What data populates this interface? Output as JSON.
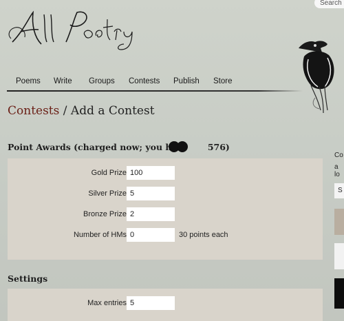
{
  "header": {
    "logo_text": "All Poetry",
    "search_label": "Search"
  },
  "nav": {
    "items": [
      {
        "label": "Poems"
      },
      {
        "label": "Write"
      },
      {
        "label": "Groups"
      },
      {
        "label": "Contests"
      },
      {
        "label": "Publish"
      },
      {
        "label": "Store"
      }
    ]
  },
  "breadcrumb": {
    "parent": "Contests",
    "separator": " / ",
    "current": "Add a Contest"
  },
  "point_awards": {
    "title_prefix": "Point Awards (charged now; you have",
    "title_suffix": "576)",
    "fields": [
      {
        "label": "Gold Prize",
        "value": "100",
        "suffix": ""
      },
      {
        "label": "Silver Prize",
        "value": "5",
        "suffix": ""
      },
      {
        "label": "Bronze Prize",
        "value": "2",
        "suffix": ""
      },
      {
        "label": "Number of HMs",
        "value": "0",
        "suffix": "30 points each"
      }
    ]
  },
  "settings": {
    "title": "Settings",
    "fields": [
      {
        "label": "Max entries",
        "value": "5"
      }
    ]
  },
  "sidebar": {
    "fragment_1": "Co",
    "fragment_2": "a lo",
    "button_fragment": "S"
  },
  "colors": {
    "breadcrumb_link": "#6b2017",
    "panel_bg": "#d9d4cb",
    "page_bg": "#c9cdc6"
  }
}
